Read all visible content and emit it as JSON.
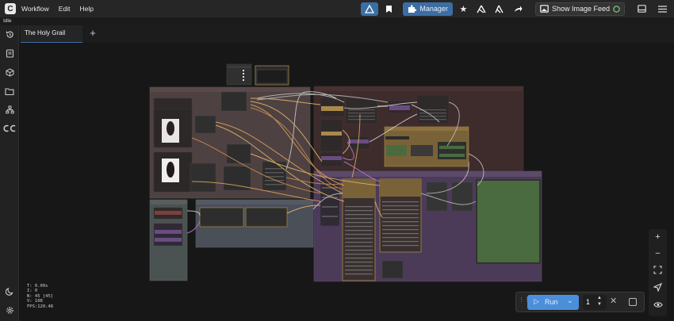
{
  "menu": {
    "workflow": "Workflow",
    "edit": "Edit",
    "help": "Help"
  },
  "toolbar": {
    "manager_label": "Manager",
    "feed_label": "Show Image Feed"
  },
  "status": "Idle",
  "tabs": [
    {
      "label": "The Holy Grail"
    }
  ],
  "stats": {
    "t": "T: 0.00s",
    "i": "I: 0",
    "n": "N: 45 [45]",
    "v": "V: 108",
    "fps": "FPS:120.48"
  },
  "run": {
    "label": "Run",
    "batch_count": "1"
  },
  "colors": {
    "accent": "#3b6ea5",
    "run": "#4b8fdb",
    "group_brown": "#4e4141",
    "group_purple": "#4c3b58",
    "group_gray": "#4a4f58",
    "node_gold": "#a98a4a",
    "node_purple": "#6a4c82",
    "node_green": "#4a6b40"
  }
}
